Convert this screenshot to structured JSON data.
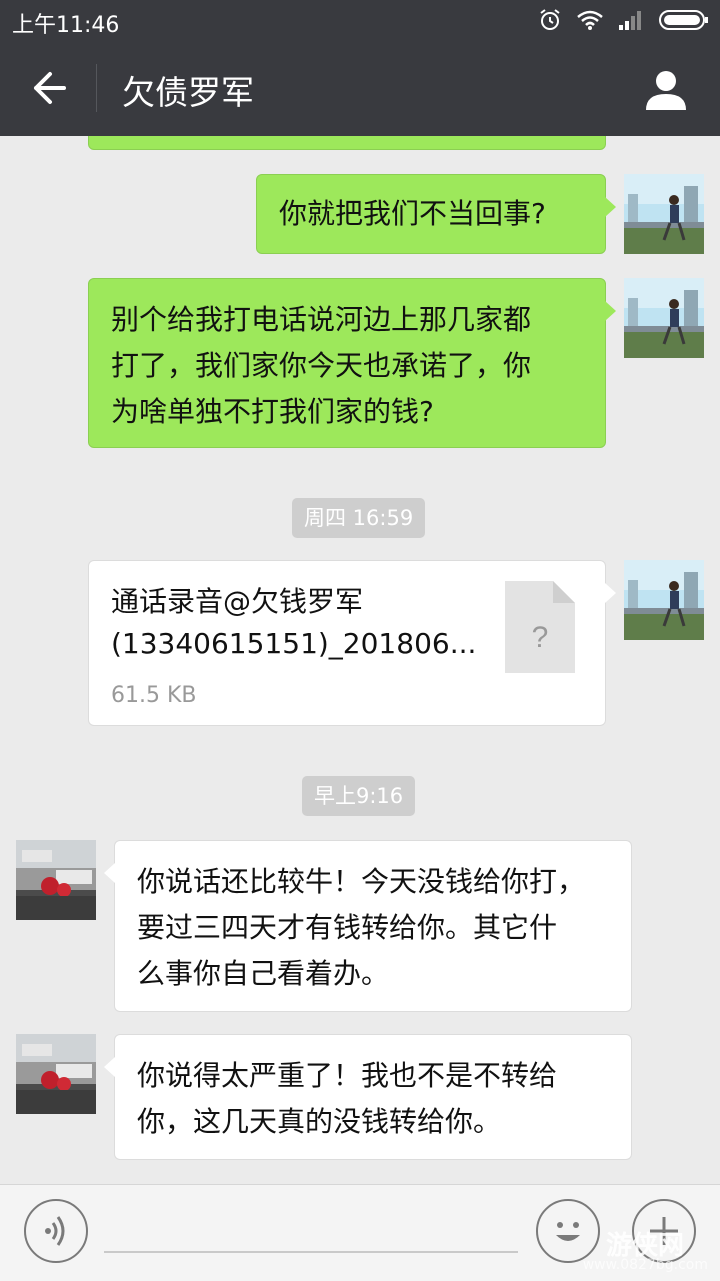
{
  "status_bar": {
    "time": "上午11:46"
  },
  "header": {
    "title": "欠债罗军"
  },
  "messages": [
    {
      "side": "right",
      "text": "你就把我们不当回事?"
    },
    {
      "side": "right",
      "lines": [
        "别个给我打电话说河边上那几家都",
        "打了，我们家你今天也承诺了，你",
        "为啥单独不打我们家的钱?"
      ]
    },
    {
      "timestamp": "周四 16:59"
    },
    {
      "side": "right",
      "file": {
        "name_line1": "通话录音@欠钱罗军",
        "name_line2": "(13340615151)_201806...",
        "size": "61.5 KB"
      }
    },
    {
      "timestamp": "早上9:16"
    },
    {
      "side": "left",
      "lines": [
        "你说话还比较牛！今天没钱给你打，",
        "要过三四天才有钱转给你。其它什",
        "么事你自己看着办。"
      ]
    },
    {
      "side": "left",
      "lines": [
        "你说得太严重了！我也不是不转给",
        "你，这几天真的没钱转给你。"
      ]
    }
  ],
  "watermark": {
    "line1": "游侠网",
    "line2": "www.0827bg.com"
  },
  "icons": [
    "back-arrow-icon",
    "contact-icon",
    "voice-icon",
    "emoji-icon",
    "plus-icon",
    "file-unknown-icon",
    "alarm-icon",
    "wifi-icon",
    "signal-icon",
    "battery-icon"
  ]
}
